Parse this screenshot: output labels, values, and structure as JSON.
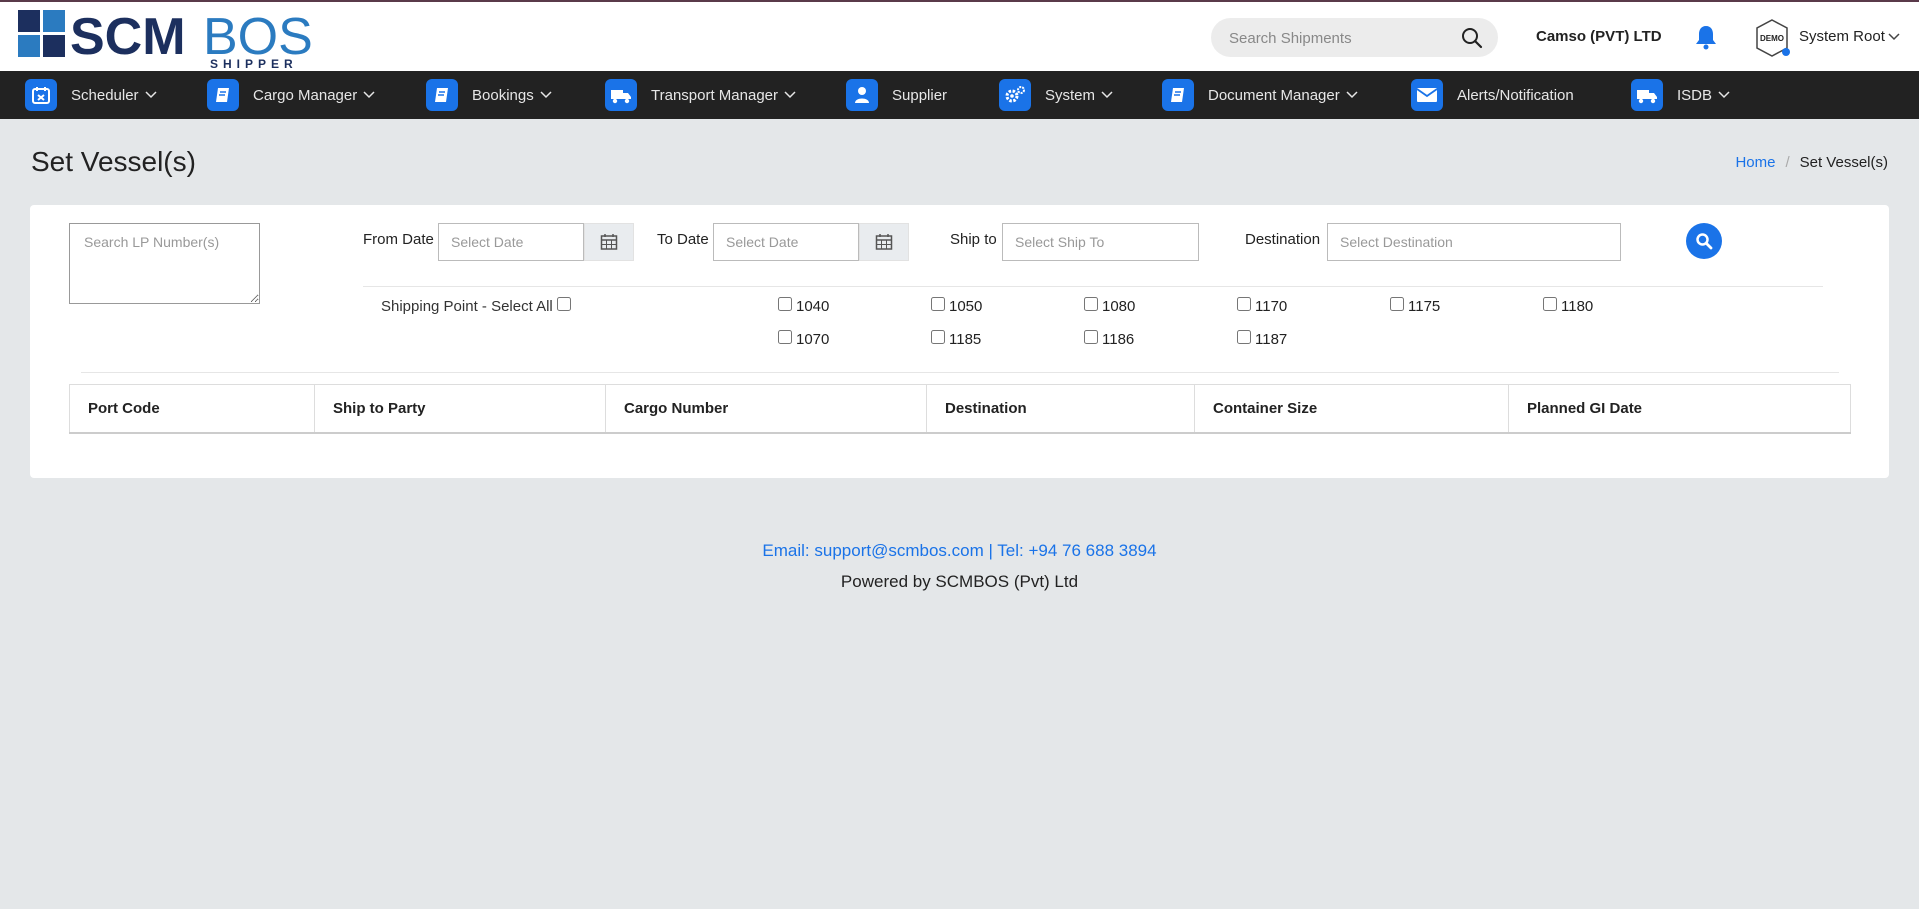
{
  "header": {
    "logo_text_main": "SCM",
    "logo_text_accent": "BOS",
    "logo_subtext": "SHIPPER",
    "search_placeholder": "Search Shipments",
    "company": "Camso (PVT) LTD",
    "avatar_text": "DEMO",
    "user": "System Root"
  },
  "nav": {
    "items": [
      {
        "label": "Scheduler",
        "icon": "calendar-icon",
        "has_menu": true
      },
      {
        "label": "Cargo Manager",
        "icon": "book-icon",
        "has_menu": true
      },
      {
        "label": "Bookings",
        "icon": "book-icon",
        "has_menu": true
      },
      {
        "label": "Transport Manager",
        "icon": "truck-icon",
        "has_menu": true
      },
      {
        "label": "Supplier",
        "icon": "user-icon",
        "has_menu": false
      },
      {
        "label": "System",
        "icon": "gears-icon",
        "has_menu": true
      },
      {
        "label": "Document Manager",
        "icon": "book-icon",
        "has_menu": true
      },
      {
        "label": "Alerts/Notification",
        "icon": "envelope-icon",
        "has_menu": false
      },
      {
        "label": "ISDB",
        "icon": "truck-icon",
        "has_menu": true
      }
    ]
  },
  "page": {
    "title": "Set Vessel(s)",
    "breadcrumb_home": "Home",
    "breadcrumb_sep": "/",
    "breadcrumb_current": "Set Vessel(s)"
  },
  "filters": {
    "lp_placeholder": "Search LP Number(s)",
    "from_label": "From Date",
    "from_placeholder": "Select Date",
    "to_label": "To Date",
    "to_placeholder": "Select Date",
    "ship_to_label": "Ship to",
    "ship_to_placeholder": "Select Ship To",
    "destination_label": "Destination",
    "destination_placeholder": "Select Destination",
    "shipping_point_label": "Shipping Point - Select All",
    "shipping_points": [
      "1040",
      "1050",
      "1080",
      "1170",
      "1175",
      "1180",
      "1070",
      "1185",
      "1186",
      "1187"
    ]
  },
  "table": {
    "columns": [
      "Port Code",
      "Ship to Party",
      "Cargo Number",
      "Destination",
      "Container Size",
      "Planned GI Date"
    ]
  },
  "footer": {
    "contact": "Email: support@scmbos.com | Tel: +94 76 688 3894",
    "powered": "Powered by SCMBOS (Pvt) Ltd"
  },
  "colors": {
    "accent": "#1a73e8",
    "nav_bg": "#222222",
    "page_bg": "#e4e7e9",
    "logo_dark": "#1c2f5e",
    "logo_blue": "#2b7bc0"
  }
}
